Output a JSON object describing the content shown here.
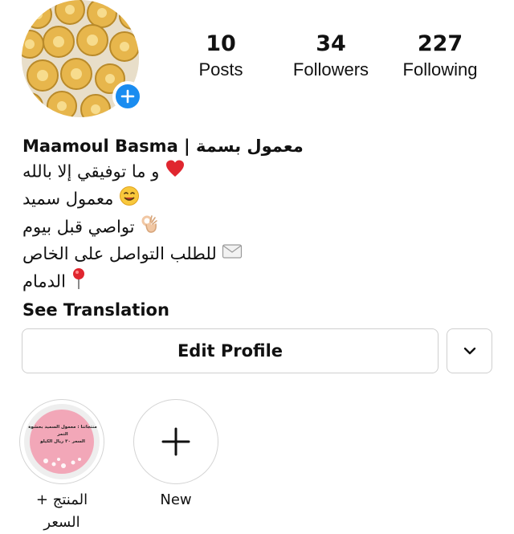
{
  "profile": {
    "stats": [
      {
        "value": "10",
        "label": "Posts"
      },
      {
        "value": "34",
        "label": "Followers"
      },
      {
        "value": "227",
        "label": "Following"
      }
    ],
    "display_name": "Maamoul Basma | معمول بسمة",
    "bio_lines": [
      {
        "text": "و ما توفيقي إلا بالله",
        "icon": "red-heart-icon"
      },
      {
        "text": "معمول سميد",
        "icon": "smiling-face-icon"
      },
      {
        "text": "تواصي قبل بيوم",
        "icon": "ok-hand-icon"
      },
      {
        "text": "للطلب التواصل على الخاص",
        "icon": "envelope-icon"
      },
      {
        "text": "الدمام",
        "icon": "round-pushpin-icon"
      }
    ],
    "see_translation": "See Translation"
  },
  "buttons": {
    "edit_profile": "Edit Profile"
  },
  "highlights": [
    {
      "label": "المنتج + السعر",
      "cover_lines": [
        "منتجاتنا : معمول السميد بحشوة التمر",
        "السعر ٣٠ ريال الكيلو"
      ]
    },
    {
      "label": "New"
    }
  ],
  "colors": {
    "accent_blue": "#1a8cf0",
    "heart_red": "#e0262f",
    "highlight_pink": "#f2a7b8"
  }
}
